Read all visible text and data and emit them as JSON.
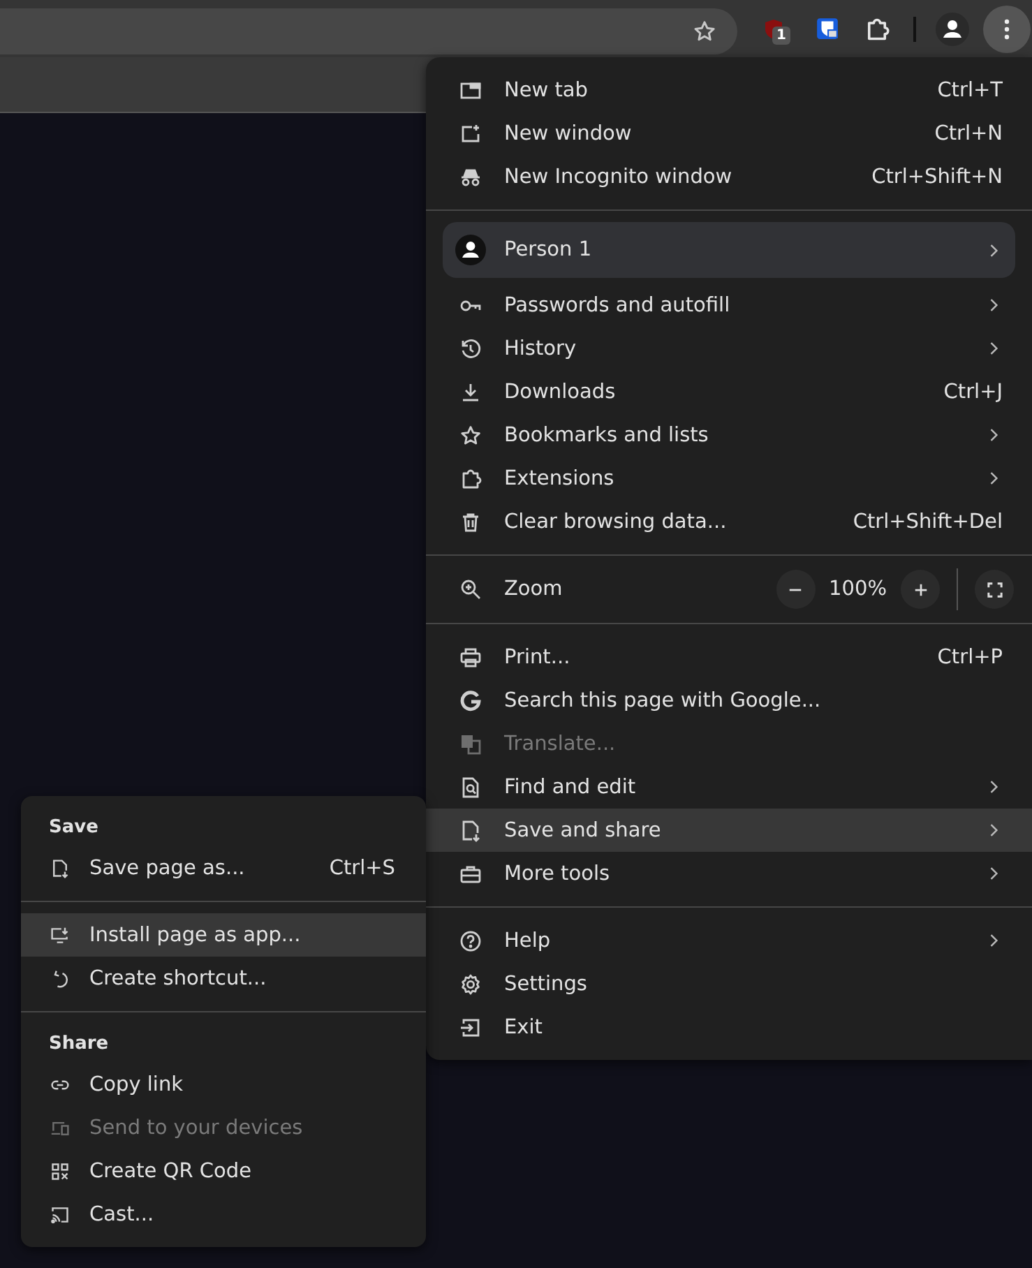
{
  "toolbar": {
    "extension_badge": "1"
  },
  "menu": {
    "sections": [
      [
        {
          "kind": "item",
          "label": "New tab",
          "shortcut": "Ctrl+T",
          "submenu": false,
          "selected": false,
          "disabled": false
        },
        {
          "kind": "item",
          "label": "New window",
          "shortcut": "Ctrl+N",
          "submenu": false,
          "selected": false,
          "disabled": false
        },
        {
          "kind": "item",
          "label": "New Incognito window",
          "shortcut": "Ctrl+Shift+N",
          "submenu": false,
          "selected": false,
          "disabled": false
        }
      ],
      [
        {
          "kind": "profile",
          "label": "Person 1",
          "submenu": true,
          "selected": false,
          "disabled": false
        },
        {
          "kind": "item",
          "label": "Passwords and autofill",
          "submenu": true,
          "selected": false,
          "disabled": false
        },
        {
          "kind": "item",
          "label": "History",
          "submenu": true,
          "selected": false,
          "disabled": false
        },
        {
          "kind": "item",
          "label": "Downloads",
          "shortcut": "Ctrl+J",
          "submenu": false,
          "selected": false,
          "disabled": false
        },
        {
          "kind": "item",
          "label": "Bookmarks and lists",
          "submenu": true,
          "selected": false,
          "disabled": false
        },
        {
          "kind": "item",
          "label": "Extensions",
          "submenu": true,
          "selected": false,
          "disabled": false
        },
        {
          "kind": "item",
          "label": "Clear browsing data...",
          "shortcut": "Ctrl+Shift+Del",
          "submenu": false,
          "selected": false,
          "disabled": false
        }
      ],
      [
        {
          "kind": "zoom",
          "label": "Zoom",
          "value": "100%"
        }
      ],
      [
        {
          "kind": "item",
          "label": "Print...",
          "shortcut": "Ctrl+P",
          "submenu": false,
          "selected": false,
          "disabled": false
        },
        {
          "kind": "item",
          "label": "Search this page with Google...",
          "submenu": false,
          "selected": false,
          "disabled": false
        },
        {
          "kind": "item",
          "label": "Translate...",
          "submenu": false,
          "selected": false,
          "disabled": true
        },
        {
          "kind": "item",
          "label": "Find and edit",
          "submenu": true,
          "selected": false,
          "disabled": false
        },
        {
          "kind": "item",
          "label": "Save and share",
          "submenu": true,
          "selected": true,
          "disabled": false
        },
        {
          "kind": "item",
          "label": "More tools",
          "submenu": true,
          "selected": false,
          "disabled": false
        }
      ],
      [
        {
          "kind": "item",
          "label": "Help",
          "submenu": true,
          "selected": false,
          "disabled": false
        },
        {
          "kind": "item",
          "label": "Settings",
          "submenu": false,
          "selected": false,
          "disabled": false
        },
        {
          "kind": "item",
          "label": "Exit",
          "submenu": false,
          "selected": false,
          "disabled": false
        }
      ]
    ]
  },
  "submenu": {
    "sections": [
      {
        "header": "Save",
        "items": [
          {
            "label": "Save page as...",
            "shortcut": "Ctrl+S",
            "selected": false,
            "disabled": false
          }
        ]
      },
      {
        "items": [
          {
            "label": "Install page as app...",
            "selected": true,
            "disabled": false
          },
          {
            "label": "Create shortcut...",
            "selected": false,
            "disabled": false
          }
        ]
      },
      {
        "header": "Share",
        "items": [
          {
            "label": "Copy link",
            "selected": false,
            "disabled": false
          },
          {
            "label": "Send to your devices",
            "selected": false,
            "disabled": true
          },
          {
            "label": "Create QR Code",
            "selected": false,
            "disabled": false
          },
          {
            "label": "Cast...",
            "selected": false,
            "disabled": false
          }
        ]
      }
    ]
  }
}
